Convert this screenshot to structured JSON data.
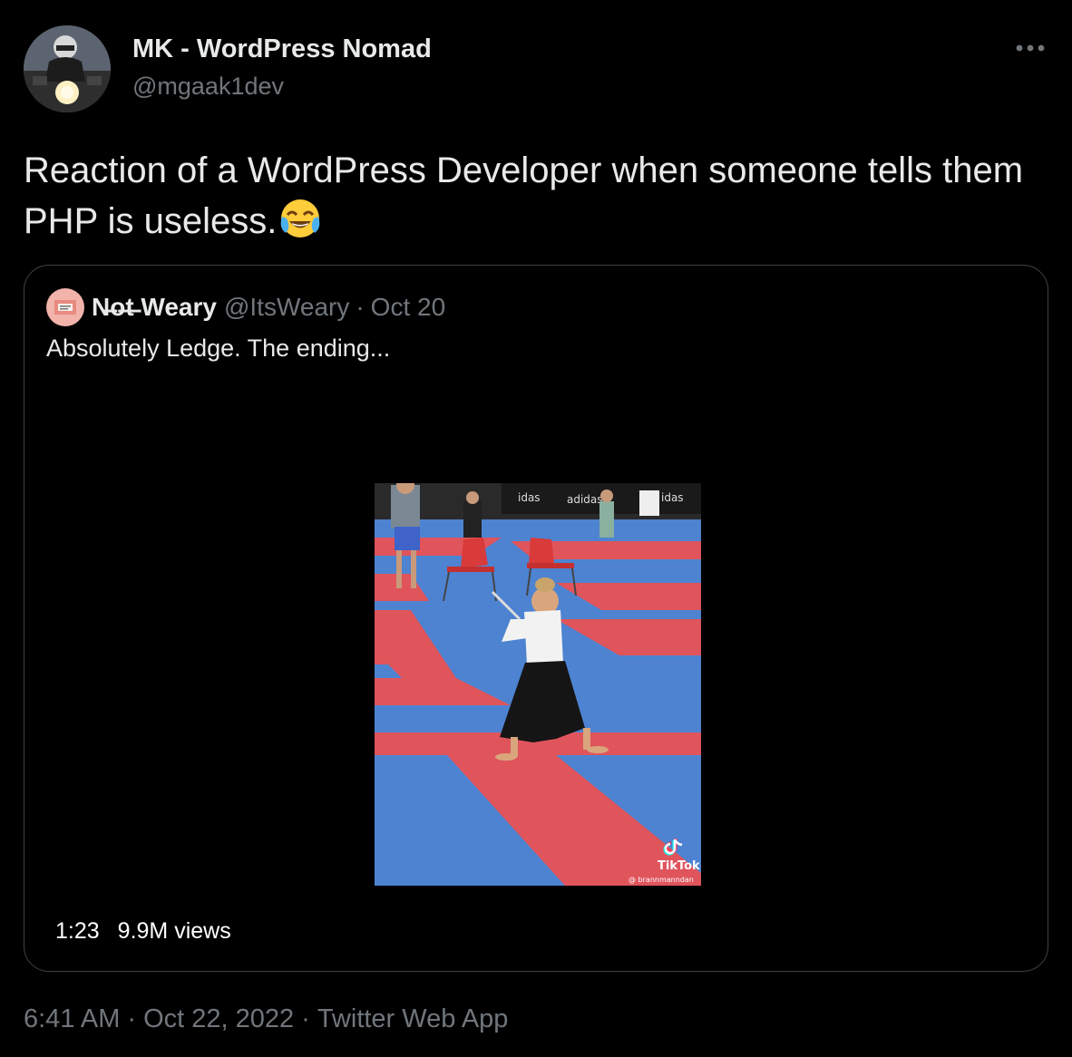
{
  "author": {
    "name": "MK - WordPress Nomad",
    "handle": "@mgaak1dev"
  },
  "tweet": {
    "text": "Reaction of a WordPress Developer when someone tells them PHP is useless.",
    "emoji": "face-with-tears-of-joy-icon"
  },
  "quote": {
    "name": "N̶o̶t̶ Weary",
    "handle": "@ItsWeary",
    "separator": "·",
    "date": "Oct 20",
    "text": "Absolutely Ledge. The ending...",
    "video": {
      "duration": "1:23",
      "views": "9.9M views",
      "watermark_brand": "TikTok",
      "watermark_user": "@ brannmanndan",
      "banner_texts": [
        "idas",
        "adidas",
        "idas"
      ]
    }
  },
  "footer": {
    "time": "6:41 AM",
    "separator": "·",
    "date": "Oct 22, 2022",
    "source": "Twitter Web App"
  },
  "colors": {
    "background": "#000000",
    "primary_text": "#e7e9ea",
    "secondary_text": "#71767b",
    "card_border": "#3e4144"
  }
}
